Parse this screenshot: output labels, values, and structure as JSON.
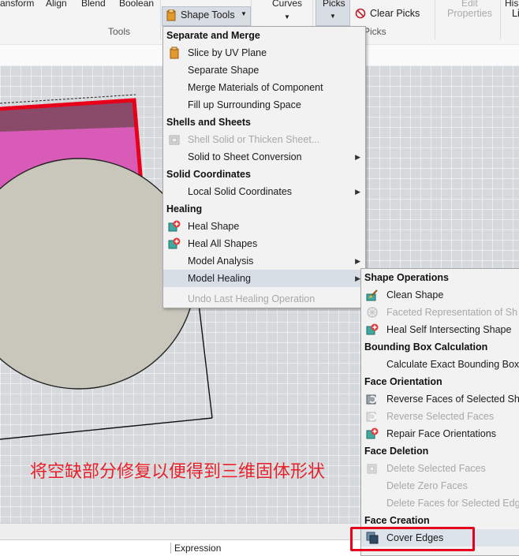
{
  "ribbon": {
    "tab_labels": [
      "ansform",
      "Align",
      "Blend",
      "Boolean",
      "Curves",
      "Picks",
      "Edit",
      "His"
    ],
    "shape_tools_button": "Shape Tools",
    "clear_picks": "Clear Picks",
    "properties": "Properties",
    "li": "Li",
    "tools_group": "Tools",
    "picks_group": "Picks"
  },
  "menu1": {
    "items": [
      {
        "type": "header",
        "label": "Separate and Merge"
      },
      {
        "type": "item",
        "label": "Slice by UV Plane",
        "icon": "slice-icon"
      },
      {
        "type": "item",
        "label": "Separate Shape"
      },
      {
        "type": "item",
        "label": "Merge Materials of Component"
      },
      {
        "type": "item",
        "label": "Fill up Surrounding Space"
      },
      {
        "type": "header",
        "label": "Shells and Sheets"
      },
      {
        "type": "item",
        "label": "Shell Solid or Thicken Sheet...",
        "disabled": true,
        "icon": "shell-icon"
      },
      {
        "type": "item",
        "label": "Solid to Sheet Conversion",
        "submenu": true
      },
      {
        "type": "header",
        "label": "Solid Coordinates"
      },
      {
        "type": "item",
        "label": "Local Solid Coordinates",
        "submenu": true
      },
      {
        "type": "header",
        "label": "Healing"
      },
      {
        "type": "item",
        "label": "Heal Shape",
        "icon": "heal-icon"
      },
      {
        "type": "item",
        "label": "Heal All Shapes",
        "icon": "heal-icon"
      },
      {
        "type": "item",
        "label": "Model Analysis",
        "submenu": true
      },
      {
        "type": "item",
        "label": "Model Healing",
        "submenu": true,
        "highlighted": true
      },
      {
        "type": "item",
        "label": "Undo Last Healing Operation",
        "disabled": true
      }
    ]
  },
  "menu2": {
    "items": [
      {
        "type": "header",
        "label": "Shape Operations"
      },
      {
        "type": "item",
        "label": "Clean Shape",
        "icon": "clean-icon"
      },
      {
        "type": "item",
        "label": "Faceted Representation of Sh",
        "disabled": true,
        "icon": "facet-icon"
      },
      {
        "type": "item",
        "label": "Heal Self Intersecting Shape",
        "icon": "heal-icon"
      },
      {
        "type": "header",
        "label": "Bounding Box Calculation"
      },
      {
        "type": "item",
        "label": "Calculate Exact Bounding Box"
      },
      {
        "type": "header",
        "label": "Face Orientation"
      },
      {
        "type": "item",
        "label": "Reverse Faces of Selected Sha",
        "icon": "reverse-icon"
      },
      {
        "type": "item",
        "label": "Reverse Selected Faces",
        "disabled": true,
        "icon": "reverse-icon"
      },
      {
        "type": "item",
        "label": "Repair Face Orientations",
        "icon": "heal-icon"
      },
      {
        "type": "header",
        "label": "Face Deletion"
      },
      {
        "type": "item",
        "label": "Delete Selected Faces",
        "disabled": true,
        "icon": "delete-icon"
      },
      {
        "type": "item",
        "label": "Delete Zero Faces",
        "disabled": true
      },
      {
        "type": "item",
        "label": "Delete Faces for Selected Edg",
        "disabled": true
      },
      {
        "type": "header",
        "label": "Face Creation"
      },
      {
        "type": "item",
        "label": "Cover Edges",
        "highlighted": true,
        "icon": "cover-icon"
      }
    ]
  },
  "annotation": "将空缺部分修复以便得到三维固体形状",
  "bottom": {
    "expression_header": "Expression"
  },
  "colors": {
    "accent_red": "#e5001b",
    "shape_magenta": "#d95bb8",
    "shape_dark": "#8a4a6a",
    "grid_bg": "#d6d9dc",
    "disc": "#c9c6bc"
  }
}
